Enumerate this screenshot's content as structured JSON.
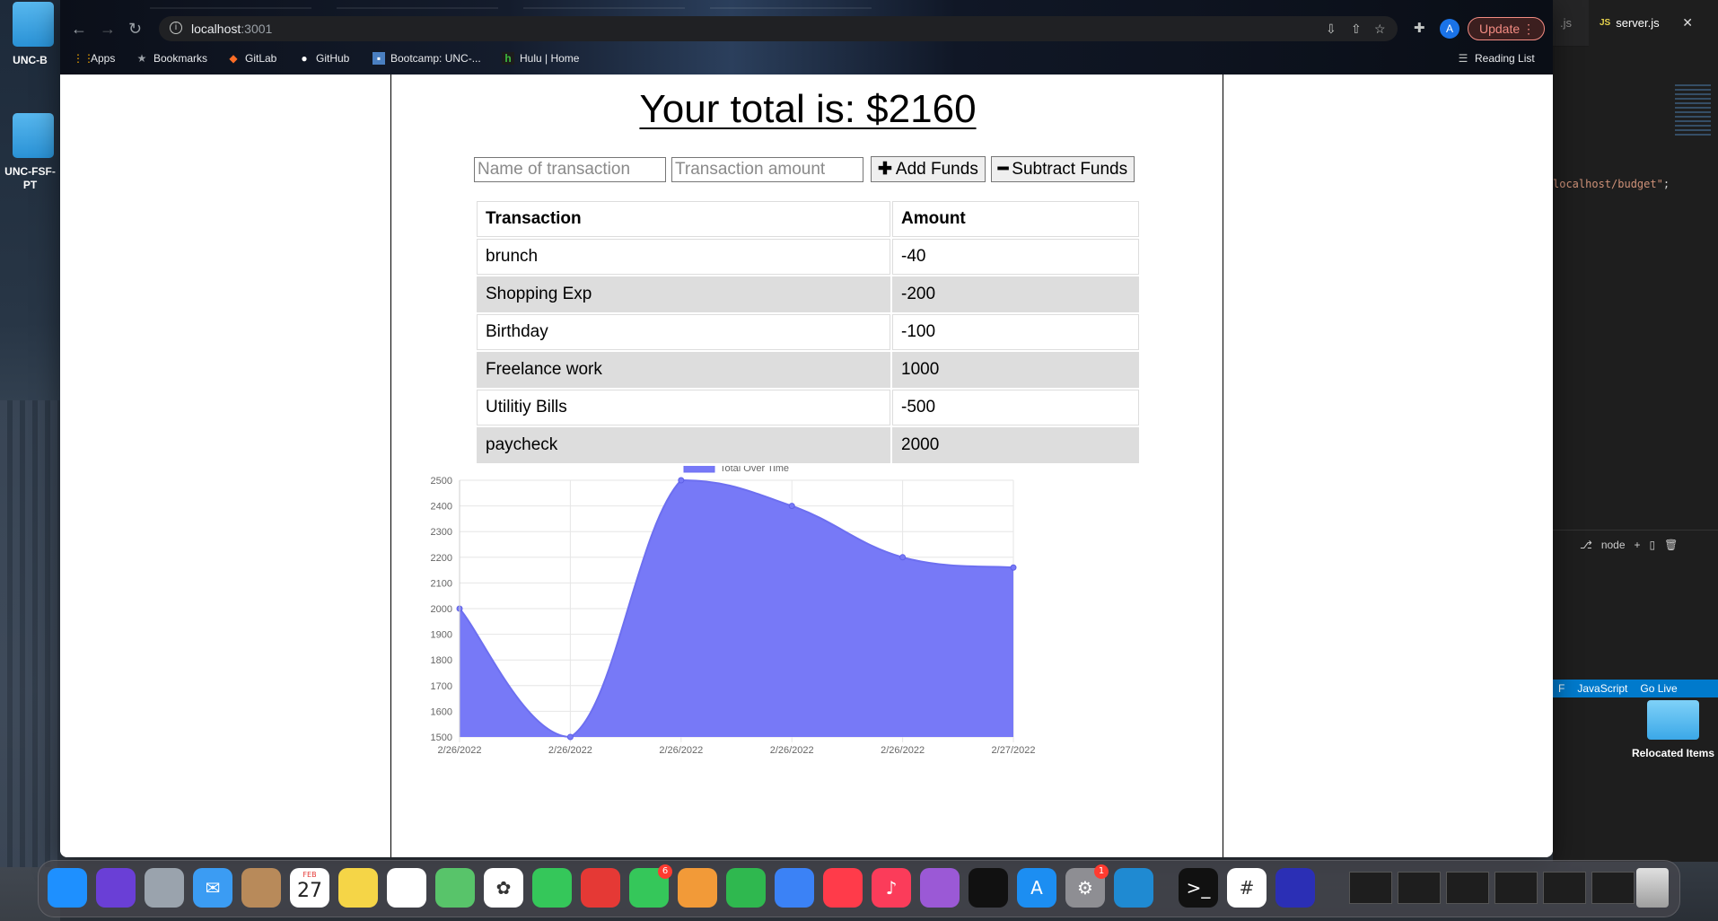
{
  "desktop": {
    "left_labels": [
      "UNC-B",
      "UNC-FSF-PT"
    ],
    "right_panel": {
      "prev_tab": ".js",
      "tab_label": "server.js",
      "code_snippet": "localhost/budget\"",
      "code_end": ";",
      "terminal_label": "node",
      "status_language": "JavaScript",
      "status_golive": "Go Live",
      "status_prefix": "F"
    },
    "relocated_label": "Relocated Items"
  },
  "browser": {
    "address": {
      "host": "localhost",
      "port": ":3001"
    },
    "update_label": "Update",
    "profile_initial": "A",
    "bookmarks": [
      {
        "label": "Apps",
        "icon": "apps-grid-icon"
      },
      {
        "label": "Bookmarks",
        "icon": "star-icon"
      },
      {
        "label": "GitLab",
        "icon": "gitlab-icon"
      },
      {
        "label": "GitHub",
        "icon": "github-icon"
      },
      {
        "label": "Bootcamp: UNC-...",
        "icon": "bootcamp-icon"
      },
      {
        "label": "Hulu | Home",
        "icon": "hulu-icon"
      }
    ],
    "reading_list": "Reading List"
  },
  "page": {
    "total_text": "Your total is: $2160",
    "name_placeholder": "Name of transaction",
    "amount_placeholder": "Transaction amount",
    "add_button": "Add Funds",
    "subtract_button": "Subtract Funds",
    "table": {
      "headers": [
        "Transaction",
        "Amount"
      ],
      "rows": [
        [
          "brunch",
          "-40"
        ],
        [
          "Shopping Exp",
          "-200"
        ],
        [
          "Birthday",
          "-100"
        ],
        [
          "Freelance work",
          "1000"
        ],
        [
          "Utilitiy Bills",
          "-500"
        ],
        [
          "paycheck",
          "2000"
        ]
      ]
    }
  },
  "chart_data": {
    "type": "area",
    "x": [
      "2/26/2022",
      "2/26/2022",
      "2/26/2022",
      "2/26/2022",
      "2/26/2022",
      "2/27/2022"
    ],
    "series": [
      {
        "name": "Total Over Time",
        "values": [
          2000,
          1500,
          2500,
          2400,
          2200,
          2160
        ],
        "color": "#7779f7"
      }
    ],
    "ylim": [
      1500,
      2500
    ],
    "yticks": [
      2500,
      2400,
      2300,
      2200,
      2100,
      2000,
      1900,
      1800,
      1700,
      1600,
      1500
    ],
    "grid": true,
    "legend": "top-center"
  },
  "dock": {
    "calendar_month": "FEB",
    "calendar_day": "27",
    "facetime_badge": "6",
    "settings_badge": "1"
  },
  "colors": {
    "accent": "#7779f7",
    "update": "#f28b82",
    "vscode_status": "#007acc"
  }
}
